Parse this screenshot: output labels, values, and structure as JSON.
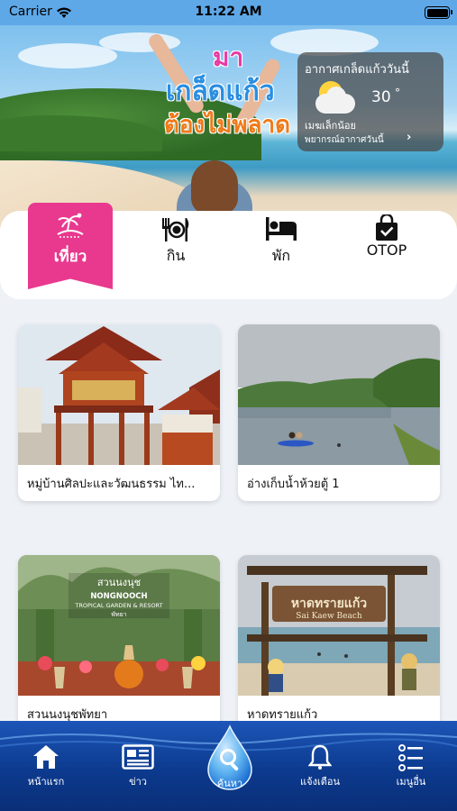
{
  "status_bar": {
    "carrier": "Carrier",
    "time": "11:22 AM"
  },
  "hero": {
    "line1": "มา",
    "line2": "เกล็ดแก้ว",
    "line3": "ต้องไม่พลาด"
  },
  "weather": {
    "title": "อากาศเกล็ดแก้ววันนี้",
    "temperature": "30",
    "degree_symbol": "°",
    "condition": "เมฆเล็กน้อย",
    "forecast_link": "พยากรณ์อากาศวันนี้",
    "icon": "partly-cloudy-icon"
  },
  "categories": [
    {
      "label": "เที่ยว",
      "icon": "travel-icon",
      "active": true
    },
    {
      "label": "กิน",
      "icon": "dining-icon",
      "active": false
    },
    {
      "label": "พัก",
      "icon": "bed-icon",
      "active": false
    },
    {
      "label": "OTOP",
      "icon": "shopping-bag-icon",
      "active": false
    }
  ],
  "places": [
    {
      "name": "หมู่บ้านศิลปะและวัฒนธรรม ไท..."
    },
    {
      "name": "อ่างเก็บน้ำห้วยตู้ 1"
    },
    {
      "name": "สวนนงนุชพัทยา"
    },
    {
      "name": "หาดทรายแก้ว"
    }
  ],
  "photo_signs": {
    "nongnooch_th": "สวนนงนุช",
    "nongnooch_en_1": "NONGNOOCH",
    "nongnooch_en_2": "TROPICAL GARDEN & RESORT",
    "nongnooch_city": "พัทยา",
    "beach_th": "หาดทรายแก้ว",
    "beach_en": "Sai Kaew Beach"
  },
  "bottom_nav": [
    {
      "label": "หน้าแรก",
      "icon": "home-icon"
    },
    {
      "label": "ข่าว",
      "icon": "news-icon"
    },
    {
      "label": "ค้นหา",
      "icon": "search-icon"
    },
    {
      "label": "แจ้งเตือน",
      "icon": "bell-icon"
    },
    {
      "label": "เมนูอื่น",
      "icon": "menu-list-icon"
    }
  ],
  "colors": {
    "accent_pink": "#e8398f",
    "nav_blue": "#0c3a8e",
    "status_blue": "#5fa8e8"
  }
}
